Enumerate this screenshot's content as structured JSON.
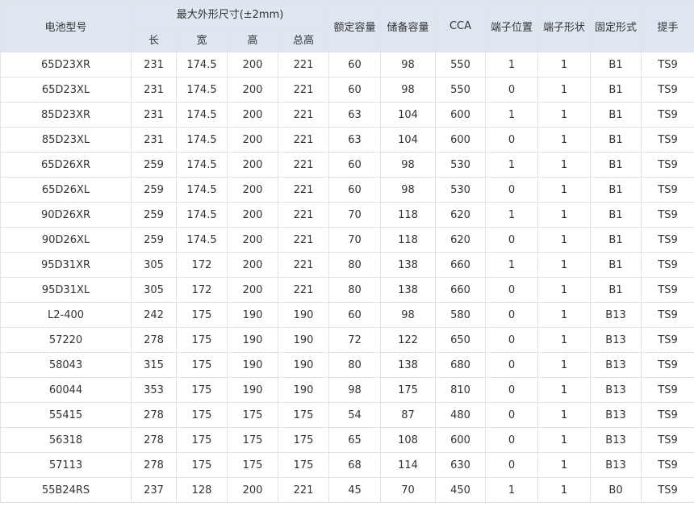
{
  "table": {
    "headers": {
      "model": "电池型号",
      "dimensions_group": "最大外形尺寸(±2mm)",
      "length": "长",
      "width": "宽",
      "height": "高",
      "total_height": "总高",
      "rated_capacity": "额定容量",
      "reserve_capacity": "储备容量",
      "cca": "CCA",
      "terminal_position": "端子位置",
      "terminal_shape": "端子形状",
      "mounting": "固定形式",
      "handle": "提手"
    },
    "rows": [
      [
        "65D23XR",
        "231",
        "174.5",
        "200",
        "221",
        "60",
        "98",
        "550",
        "1",
        "1",
        "B1",
        "TS9"
      ],
      [
        "65D23XL",
        "231",
        "174.5",
        "200",
        "221",
        "60",
        "98",
        "550",
        "0",
        "1",
        "B1",
        "TS9"
      ],
      [
        "85D23XR",
        "231",
        "174.5",
        "200",
        "221",
        "63",
        "104",
        "600",
        "1",
        "1",
        "B1",
        "TS9"
      ],
      [
        "85D23XL",
        "231",
        "174.5",
        "200",
        "221",
        "63",
        "104",
        "600",
        "0",
        "1",
        "B1",
        "TS9"
      ],
      [
        "65D26XR",
        "259",
        "174.5",
        "200",
        "221",
        "60",
        "98",
        "530",
        "1",
        "1",
        "B1",
        "TS9"
      ],
      [
        "65D26XL",
        "259",
        "174.5",
        "200",
        "221",
        "60",
        "98",
        "530",
        "0",
        "1",
        "B1",
        "TS9"
      ],
      [
        "90D26XR",
        "259",
        "174.5",
        "200",
        "221",
        "70",
        "118",
        "620",
        "1",
        "1",
        "B1",
        "TS9"
      ],
      [
        "90D26XL",
        "259",
        "174.5",
        "200",
        "221",
        "70",
        "118",
        "620",
        "0",
        "1",
        "B1",
        "TS9"
      ],
      [
        "95D31XR",
        "305",
        "172",
        "200",
        "221",
        "80",
        "138",
        "660",
        "1",
        "1",
        "B1",
        "TS9"
      ],
      [
        "95D31XL",
        "305",
        "172",
        "200",
        "221",
        "80",
        "138",
        "660",
        "0",
        "1",
        "B1",
        "TS9"
      ],
      [
        "L2-400",
        "242",
        "175",
        "190",
        "190",
        "60",
        "98",
        "580",
        "0",
        "1",
        "B13",
        "TS9"
      ],
      [
        "57220",
        "278",
        "175",
        "190",
        "190",
        "72",
        "122",
        "650",
        "0",
        "1",
        "B13",
        "TS9"
      ],
      [
        "58043",
        "315",
        "175",
        "190",
        "190",
        "80",
        "138",
        "680",
        "0",
        "1",
        "B13",
        "TS9"
      ],
      [
        "60044",
        "353",
        "175",
        "190",
        "190",
        "98",
        "175",
        "810",
        "0",
        "1",
        "B13",
        "TS9"
      ],
      [
        "55415",
        "278",
        "175",
        "175",
        "175",
        "54",
        "87",
        "480",
        "0",
        "1",
        "B13",
        "TS9"
      ],
      [
        "56318",
        "278",
        "175",
        "175",
        "175",
        "65",
        "108",
        "600",
        "0",
        "1",
        "B13",
        "TS9"
      ],
      [
        "57113",
        "278",
        "175",
        "175",
        "175",
        "68",
        "114",
        "630",
        "0",
        "1",
        "B13",
        "TS9"
      ],
      [
        "55B24RS",
        "237",
        "128",
        "200",
        "221",
        "45",
        "70",
        "450",
        "1",
        "1",
        "B0",
        "TS9"
      ]
    ]
  }
}
